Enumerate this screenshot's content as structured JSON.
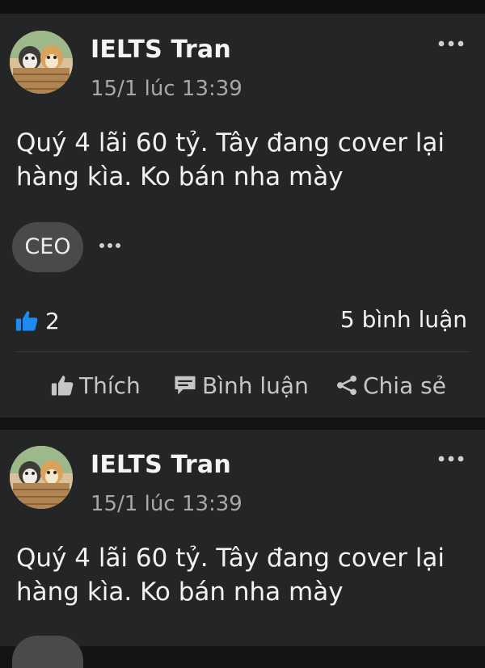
{
  "posts": [
    {
      "author": "IELTS Tran",
      "time": "15/1 lúc 13:39",
      "text_line1": "Quý 4 lãi 60 tỷ. Tây đang cover lại",
      "text_line2": "hàng kìa. Ko bán nha mày",
      "tag": "CEO",
      "like_count": "2",
      "comment_count": "5 bình luận",
      "actions": {
        "like": "Thích",
        "comment": "Bình luận",
        "share": "Chia sẻ"
      }
    },
    {
      "author": "IELTS Tran",
      "time": "15/1 lúc 13:39",
      "text_line1": "Quý 4 lãi 60 tỷ. Tây đang cover lại",
      "text_line2": "hàng kìa. Ko bán nha mày"
    }
  ],
  "icons": {
    "more": "more-horizontal-icon",
    "like": "thumbs-up-icon",
    "comment": "comment-icon",
    "share": "share-icon"
  },
  "colors": {
    "background": "#141414",
    "card": "#242526",
    "like_blue": "#1d8bf1",
    "muted": "#a8a8a8"
  }
}
